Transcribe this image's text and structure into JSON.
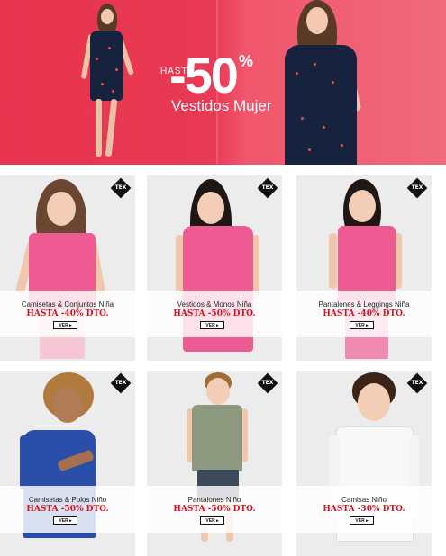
{
  "banner": {
    "hasta": "HASTA",
    "percent": "-50",
    "percent_sign": "%",
    "subtitle": "Vestidos Mujer"
  },
  "colors": {
    "banner_red": "#e8344f",
    "promo_red": "#d3141e",
    "pink_top": "#ee5b93",
    "navy": "#17223f"
  },
  "badge_label": "TEX",
  "button_label": "VER ▸",
  "cards": [
    {
      "title": "Camisetas & Conjuntos Niña",
      "promo": "HASTA -40% DTO."
    },
    {
      "title": "Vestidos & Monos Niña",
      "promo": "HASTA -50% DTO."
    },
    {
      "title": "Pantalones & Leggings Niña",
      "promo": "HASTA -40% DTO."
    },
    {
      "title": "Camisetas & Polos Niño",
      "promo": "HASTA -50% DTO."
    },
    {
      "title": "Pantalones Niño",
      "promo": "HASTA -50% DTO."
    },
    {
      "title": "Camisas Niño",
      "promo": "HASTA -30% DTO."
    }
  ]
}
